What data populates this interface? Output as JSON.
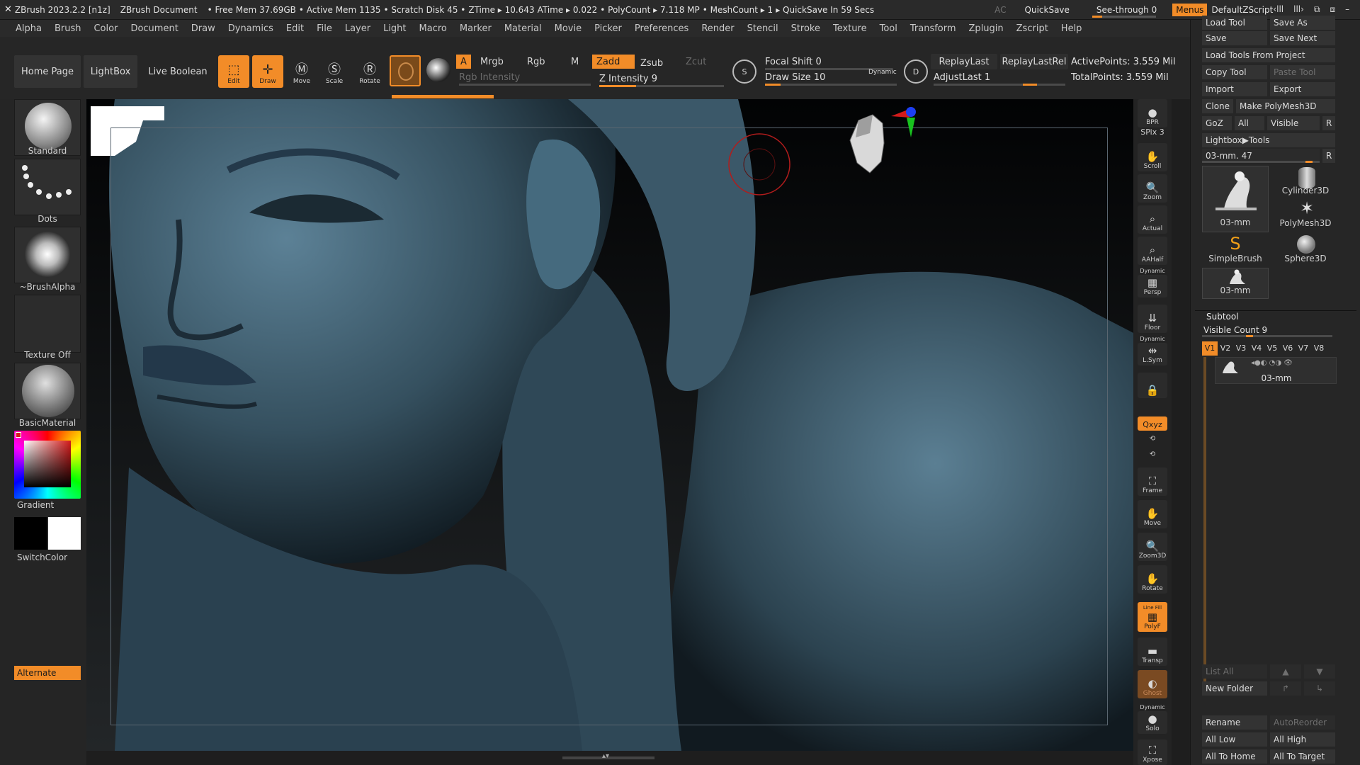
{
  "titlebar": {
    "app": "ZBrush 2023.2.2 [n1z]",
    "document": "ZBrush Document",
    "free_mem": "• Free Mem 37.69GB",
    "active_mem": "• Active Mem 1135",
    "scratch": "• Scratch Disk 45 •",
    "ztime": "ZTime ▸ 10.643",
    "atime": "ATime ▸ 0.022",
    "polycount": "• PolyCount ▸ 7.118 MP",
    "meshcount": "• MeshCount ▸ 1",
    "quicksave_info": "▸ QuickSave In 59 Secs",
    "ac": "AC",
    "quicksave": "QuickSave",
    "seethrough": "See-through  0",
    "menus": "Menus",
    "script": "DefaultZScript"
  },
  "menu": [
    "Alpha",
    "Brush",
    "Color",
    "Document",
    "Draw",
    "Dynamics",
    "Edit",
    "File",
    "Layer",
    "Light",
    "Macro",
    "Marker",
    "Material",
    "Movie",
    "Picker",
    "Preferences",
    "Render",
    "Stencil",
    "Stroke",
    "Texture",
    "Tool",
    "Transform",
    "Zplugin",
    "Zscript",
    "Help"
  ],
  "shelf": {
    "home": "Home Page",
    "lightbox": "LightBox",
    "live_boolean": "Live Boolean",
    "edit": "Edit",
    "draw": "Draw",
    "move": "Move",
    "scale": "Scale",
    "rotate": "Rotate",
    "a": "A",
    "mrgb": "Mrgb",
    "rgb": "Rgb",
    "m": "M",
    "zadd": "Zadd",
    "zsub": "Zsub",
    "zcut": "Zcut",
    "rgb_intensity": "Rgb Intensity",
    "z_intensity": "Z Intensity 9",
    "focal_shift": "Focal Shift 0",
    "draw_size": "Draw Size 10",
    "dynamic": "Dynamic",
    "replay_last": "ReplayLast",
    "replay_last_rel": "ReplayLastRel",
    "adjust_last": "AdjustLast 1",
    "active_points": "ActivePoints: 3.559 Mil",
    "total_points": "TotalPoints: 3.559 Mil",
    "s_label": "S",
    "d_label": "D"
  },
  "left": {
    "brush": "Standard",
    "stroke": "Dots",
    "alpha": "~BrushAlpha",
    "texture": "Texture Off",
    "material": "BasicMaterial",
    "gradient": "Gradient",
    "switch_color": "SwitchColor",
    "alternate": "Alternate"
  },
  "nav": {
    "bpr": "BPR",
    "spix": "SPix 3",
    "scroll": "Scroll",
    "zoom": "Zoom",
    "actual": "Actual",
    "aahalf": "AAHalf",
    "dynamic": "Dynamic",
    "persp": "Persp",
    "floor": "Floor",
    "lsym": "L.Sym",
    "xyz": "Qxyz",
    "frame": "Frame",
    "move": "Move",
    "zoom3d": "Zoom3D",
    "rotate": "Rotate",
    "linefill": "Line Fill",
    "polyf": "PolyF",
    "transp": "Transp",
    "ghost": "Ghost",
    "solo": "Solo",
    "xpose": "Xpose"
  },
  "right": {
    "load_tool": "Load Tool",
    "save_as": "Save As",
    "save": "Save",
    "save_next": "Save Next",
    "load_from_project": "Load Tools From Project",
    "copy_tool": "Copy Tool",
    "paste_tool": "Paste Tool",
    "import": "Import",
    "export": "Export",
    "clone": "Clone",
    "make_polymesh": "Make PolyMesh3D",
    "goz": "GoZ",
    "all": "All",
    "visible": "Visible",
    "r": "R",
    "lightbox_tools": "Lightbox▶Tools",
    "current_tool": "03-mm. 47",
    "tools": [
      "03-mm",
      "Cylinder3D",
      "PolyMesh3D",
      "SimpleBrush",
      "Sphere3D",
      "03-mm"
    ],
    "subtool": "Subtool",
    "visible_count": "Visible Count 9",
    "vtabs": [
      "V1",
      "V2",
      "V3",
      "V4",
      "V5",
      "V6",
      "V7",
      "V8"
    ],
    "subtool_item": "03-mm",
    "list_all": "List All",
    "new_folder": "New Folder",
    "rename": "Rename",
    "auto_reorder": "AutoReorder",
    "all_low": "All Low",
    "all_high": "All High",
    "all_to_home": "All To Home",
    "all_to_target": "All To Target"
  },
  "colors": {
    "accent": "#f28c28",
    "model": "#3f5f72"
  }
}
